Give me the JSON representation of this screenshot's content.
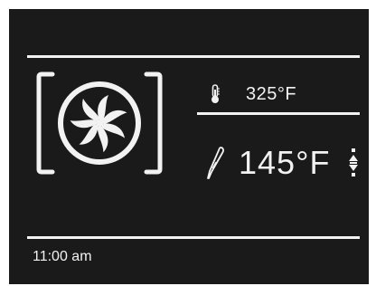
{
  "display": {
    "mode_icon": "convection-fan-icon",
    "oven_temperature": "325°F",
    "oven_temperature_icon": "thermometer-icon",
    "probe_temperature": "145°F",
    "probe_icon": "meat-probe-icon",
    "adjust_icon": "up-down-arrows-icon",
    "clock": "11:00 am"
  },
  "colors": {
    "background": "#1a1a1a",
    "foreground": "#f2f2f2",
    "frame": "#ffffff"
  }
}
